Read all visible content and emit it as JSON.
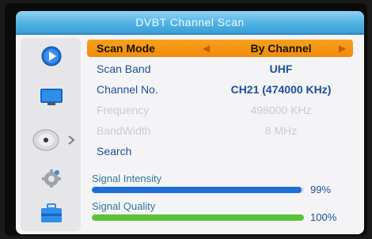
{
  "window": {
    "title": "DVBT Channel Scan"
  },
  "sidebar": {
    "icons": [
      "play-icon",
      "tv-icon",
      "satellite-dish-icon",
      "gear-icon",
      "toolbox-icon"
    ],
    "selected_index": 2
  },
  "menu": {
    "scan_mode": {
      "label": "Scan Mode",
      "value": "By Channel"
    },
    "scan_band": {
      "label": "Scan Band",
      "value": "UHF"
    },
    "channel_no": {
      "label": "Channel No.",
      "value": "CH21 (474000 KHz)"
    },
    "frequency": {
      "label": "Frequency",
      "value": "498000 KHz"
    },
    "bandwidth": {
      "label": "BandWidth",
      "value": "8 MHz"
    },
    "search": {
      "label": "Search"
    }
  },
  "signal": {
    "intensity": {
      "label": "Signal Intensity",
      "percent_text": "99%",
      "level": 0.99,
      "color": "#1f6fd6"
    },
    "quality": {
      "label": "Signal Quality",
      "percent_text": "100%",
      "level": 1.0,
      "color": "#5cc23a"
    }
  }
}
